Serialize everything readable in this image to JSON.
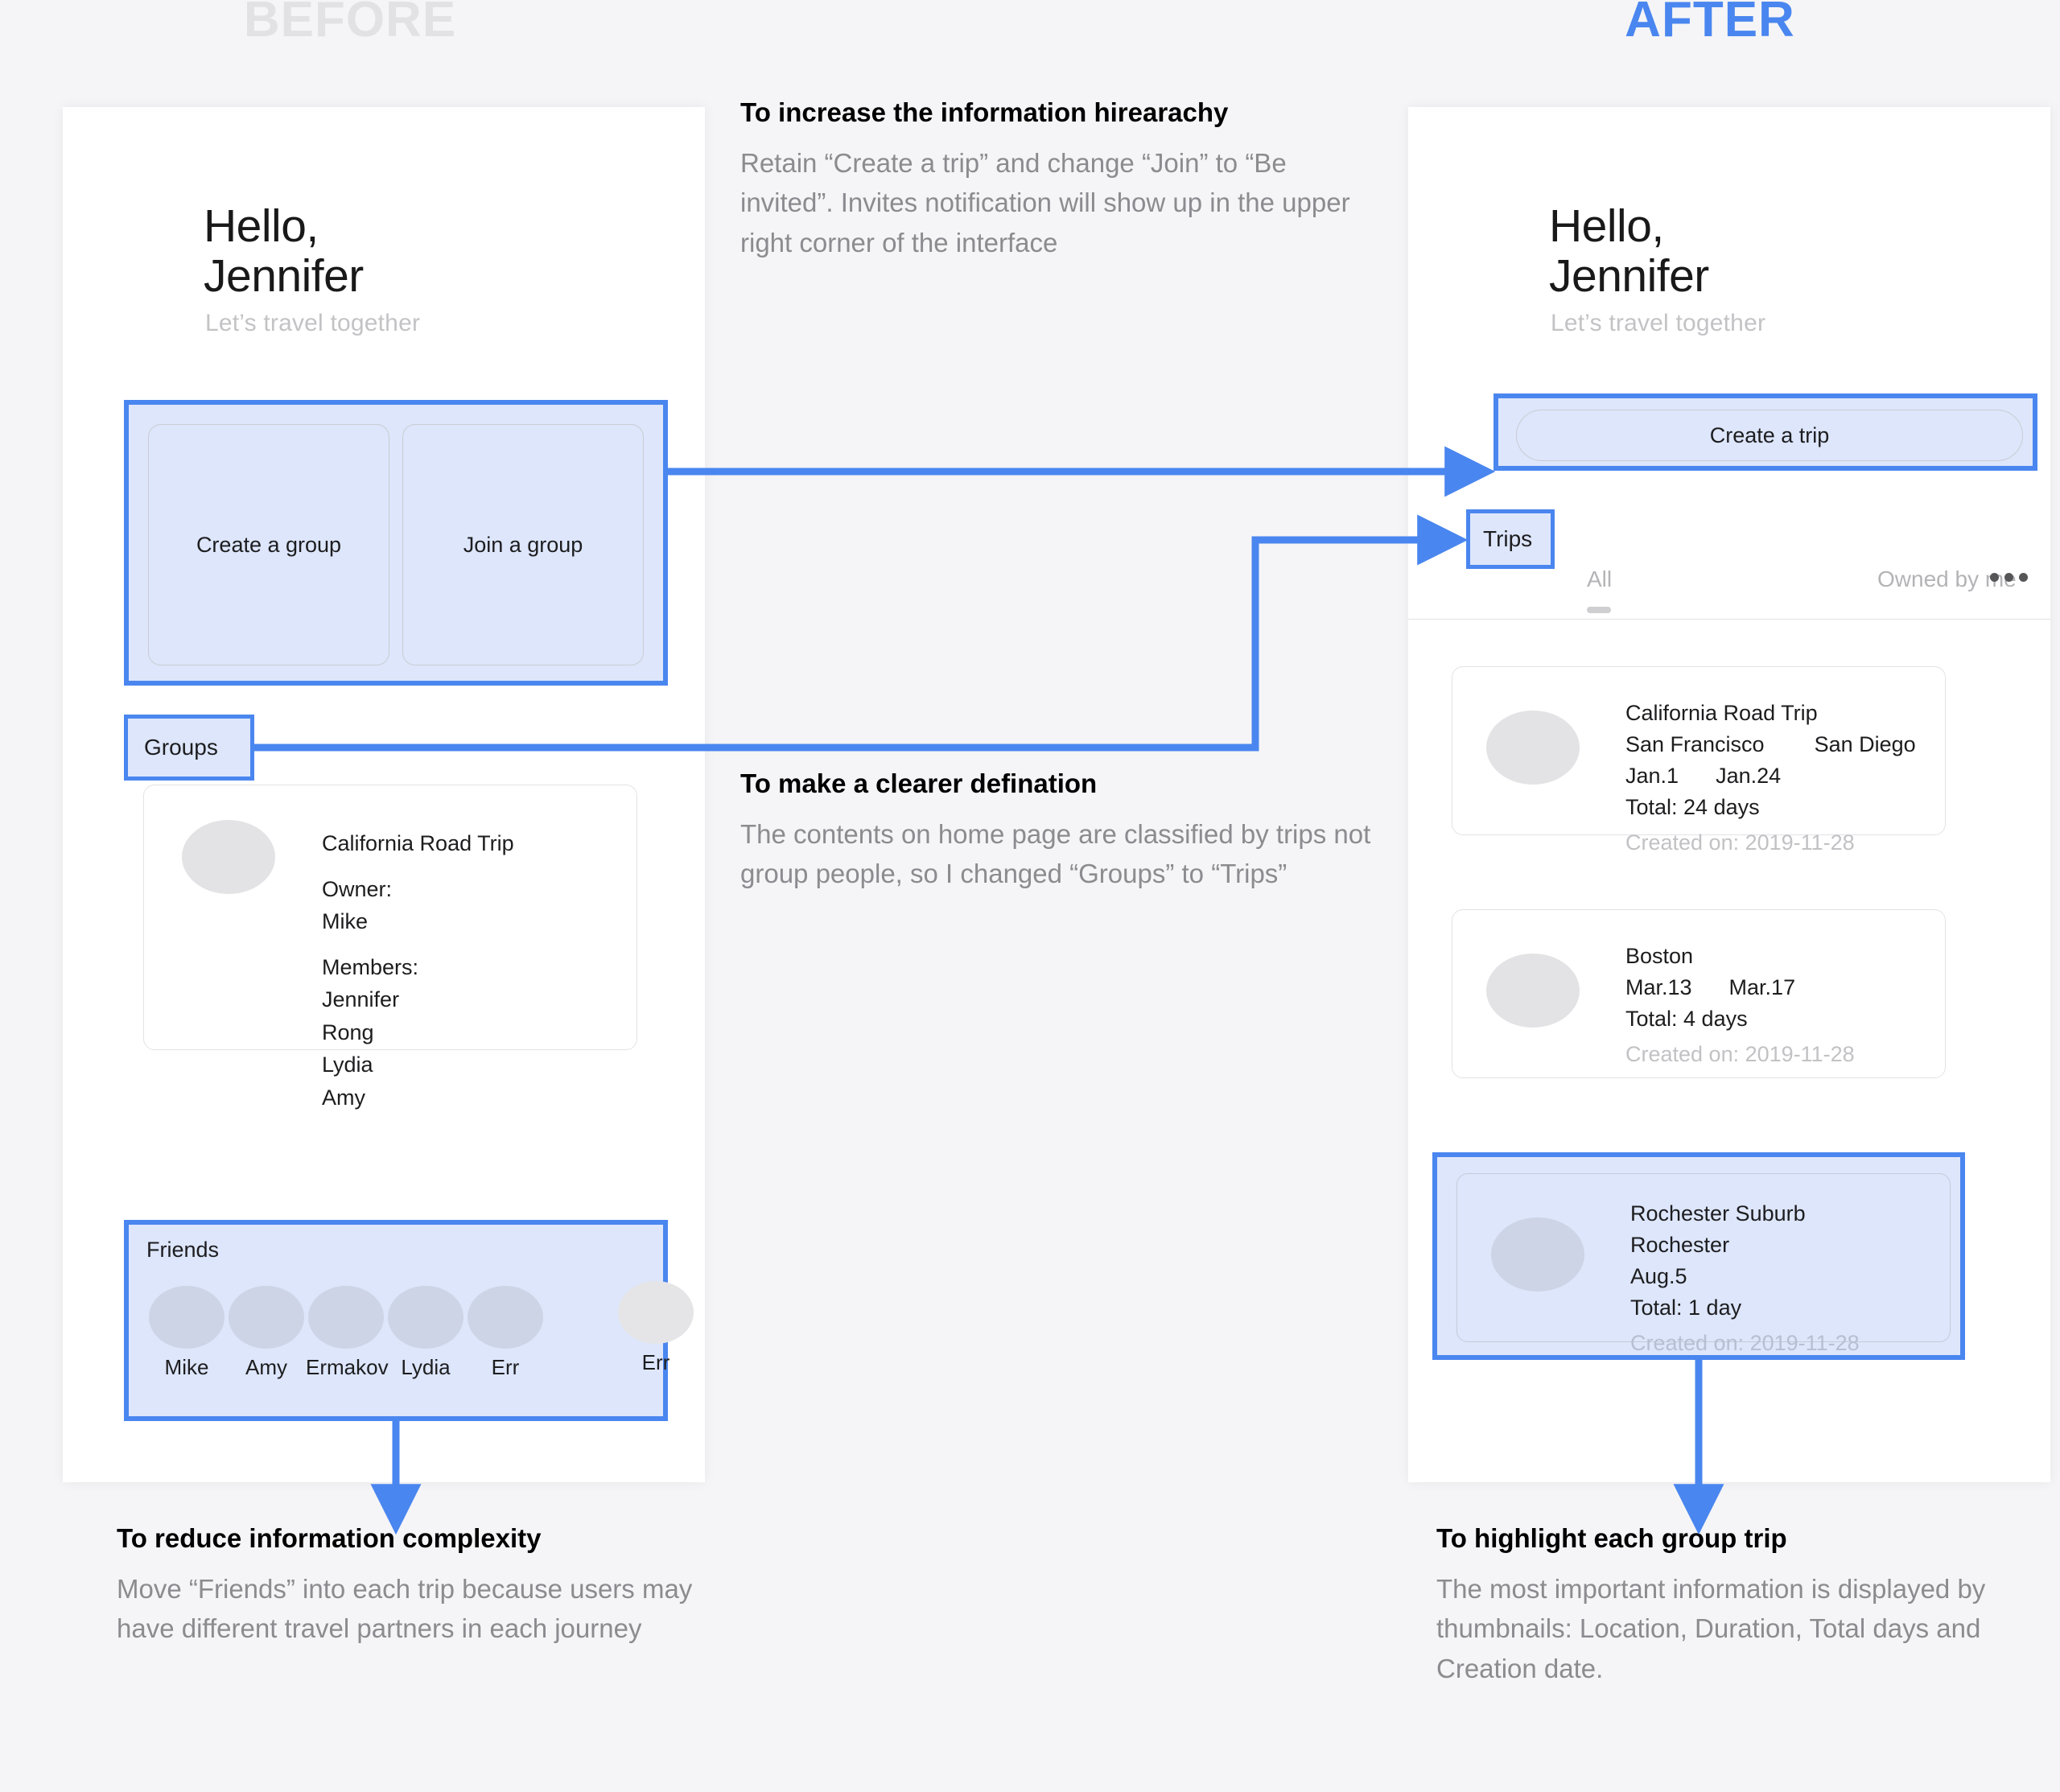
{
  "sections": {
    "before_title": "BEFORE",
    "after_title": "AFTER"
  },
  "colors": {
    "accent_blue": "#4a86ef",
    "highlight_fill": "#dde6fb",
    "page_background": "#f5f5f7",
    "muted_text": "#8b8b90"
  },
  "before_screen": {
    "greeting_line1": "Hello,",
    "greeting_line2": "Jennifer",
    "subgreeting": "Let’s travel together",
    "buttons": [
      {
        "label": "Create a group"
      },
      {
        "label": "Join a group"
      }
    ],
    "groups_tag": "Groups",
    "group_card": {
      "title": "California Road Trip",
      "owner_label": "Owner:",
      "owner": "Mike",
      "members_label": "Members:",
      "members": [
        "Jennifer",
        "Rong",
        "Lydia",
        "Amy"
      ]
    },
    "friends_label": "Friends",
    "friends": [
      "Mike",
      "Amy",
      "Ermakov",
      "Lydia"
    ],
    "friend_overflow": "Err"
  },
  "after_screen": {
    "greeting_line1": "Hello,",
    "greeting_line2": "Jennifer",
    "subgreeting": "Let’s travel together",
    "create_trip_button": "Create a trip",
    "trips_tag": "Trips",
    "tabs": [
      {
        "label": "All",
        "selected": true
      },
      {
        "label": "Owned by me",
        "selected": false
      }
    ],
    "more_icon": "ellipsis-icon",
    "trips": [
      {
        "title": "California Road Trip",
        "origin": "San Francisco",
        "destination": "San Diego",
        "start_date": "Jan.1",
        "end_date": "Jan.24",
        "total": "Total: 24 days",
        "created": "Created on: 2019-11-28"
      },
      {
        "title": "Boston",
        "origin": "",
        "destination": "",
        "start_date": "Mar.13",
        "end_date": "Mar.17",
        "total": "Total: 4 days",
        "created": "Created on: 2019-11-28"
      },
      {
        "title": "Rochester Suburb",
        "origin": "Rochester",
        "destination": "",
        "start_date": "Aug.5",
        "end_date": "",
        "total": "Total: 1 day",
        "created": "Created on: 2019-11-28"
      }
    ]
  },
  "notes": {
    "hierarchy": {
      "heading": "To increase the information hirearachy",
      "body": "Retain “Create a trip” and change “Join” to “Be invited”. Invites notification will show up in the upper right corner of the interface"
    },
    "definition": {
      "heading": "To make a clearer defination",
      "body": "The contents on home page are classified by trips not group people, so I changed “Groups” to “Trips”"
    },
    "complexity": {
      "heading": "To reduce information complexity",
      "body": "Move “Friends” into each trip because users may have different travel partners in each journey"
    },
    "highlight": {
      "heading": "To highlight each group trip",
      "body": "The most important information is displayed by thumbnails: Location, Duration, Total days and Creation date."
    }
  }
}
